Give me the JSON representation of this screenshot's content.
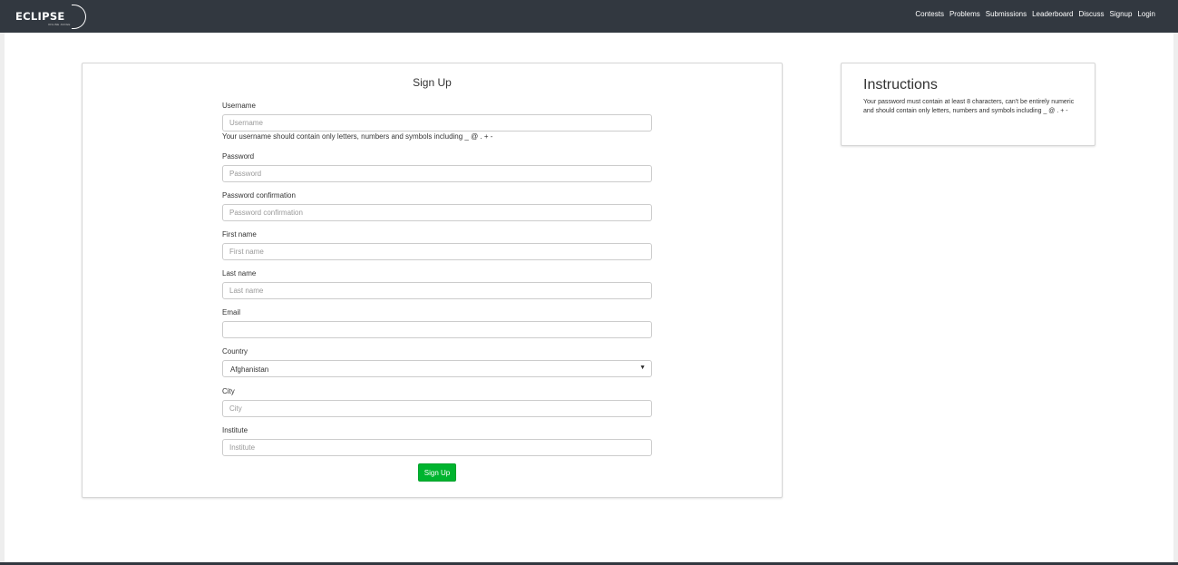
{
  "brand": {
    "name": "ECLIPSE",
    "tagline": "ONLINE JUDGE"
  },
  "nav": {
    "items": [
      "Contests",
      "Problems",
      "Submissions",
      "Leaderboard",
      "Discuss",
      "Signup",
      "Login"
    ]
  },
  "signup": {
    "title": "Sign Up",
    "username": {
      "label": "Username",
      "placeholder": "Username",
      "value": ""
    },
    "username_help": "Your username should contain only letters, numbers and symbols including _ @ . + -",
    "password": {
      "label": "Password",
      "placeholder": "Password",
      "value": ""
    },
    "password_confirmation": {
      "label": "Password confirmation",
      "placeholder": "Password confirmation",
      "value": ""
    },
    "first_name": {
      "label": "First name",
      "placeholder": "First name",
      "value": ""
    },
    "last_name": {
      "label": "Last name",
      "placeholder": "Last name",
      "value": ""
    },
    "email": {
      "label": "Email",
      "placeholder": "",
      "value": ""
    },
    "country": {
      "label": "Country",
      "selected": "Afghanistan"
    },
    "city": {
      "label": "City",
      "placeholder": "City",
      "value": ""
    },
    "institute": {
      "label": "Institute",
      "placeholder": "Institute",
      "value": ""
    },
    "submit_label": "Sign Up"
  },
  "instructions": {
    "title": "Instructions",
    "text": "Your password must contain at least 8 characters, can't be entirely numeric and should contain only letters, numbers and symbols including _ @ . + -"
  },
  "colors": {
    "navbar": "#323840",
    "accent_button": "#00b42f",
    "page_background": "#ffffff"
  }
}
